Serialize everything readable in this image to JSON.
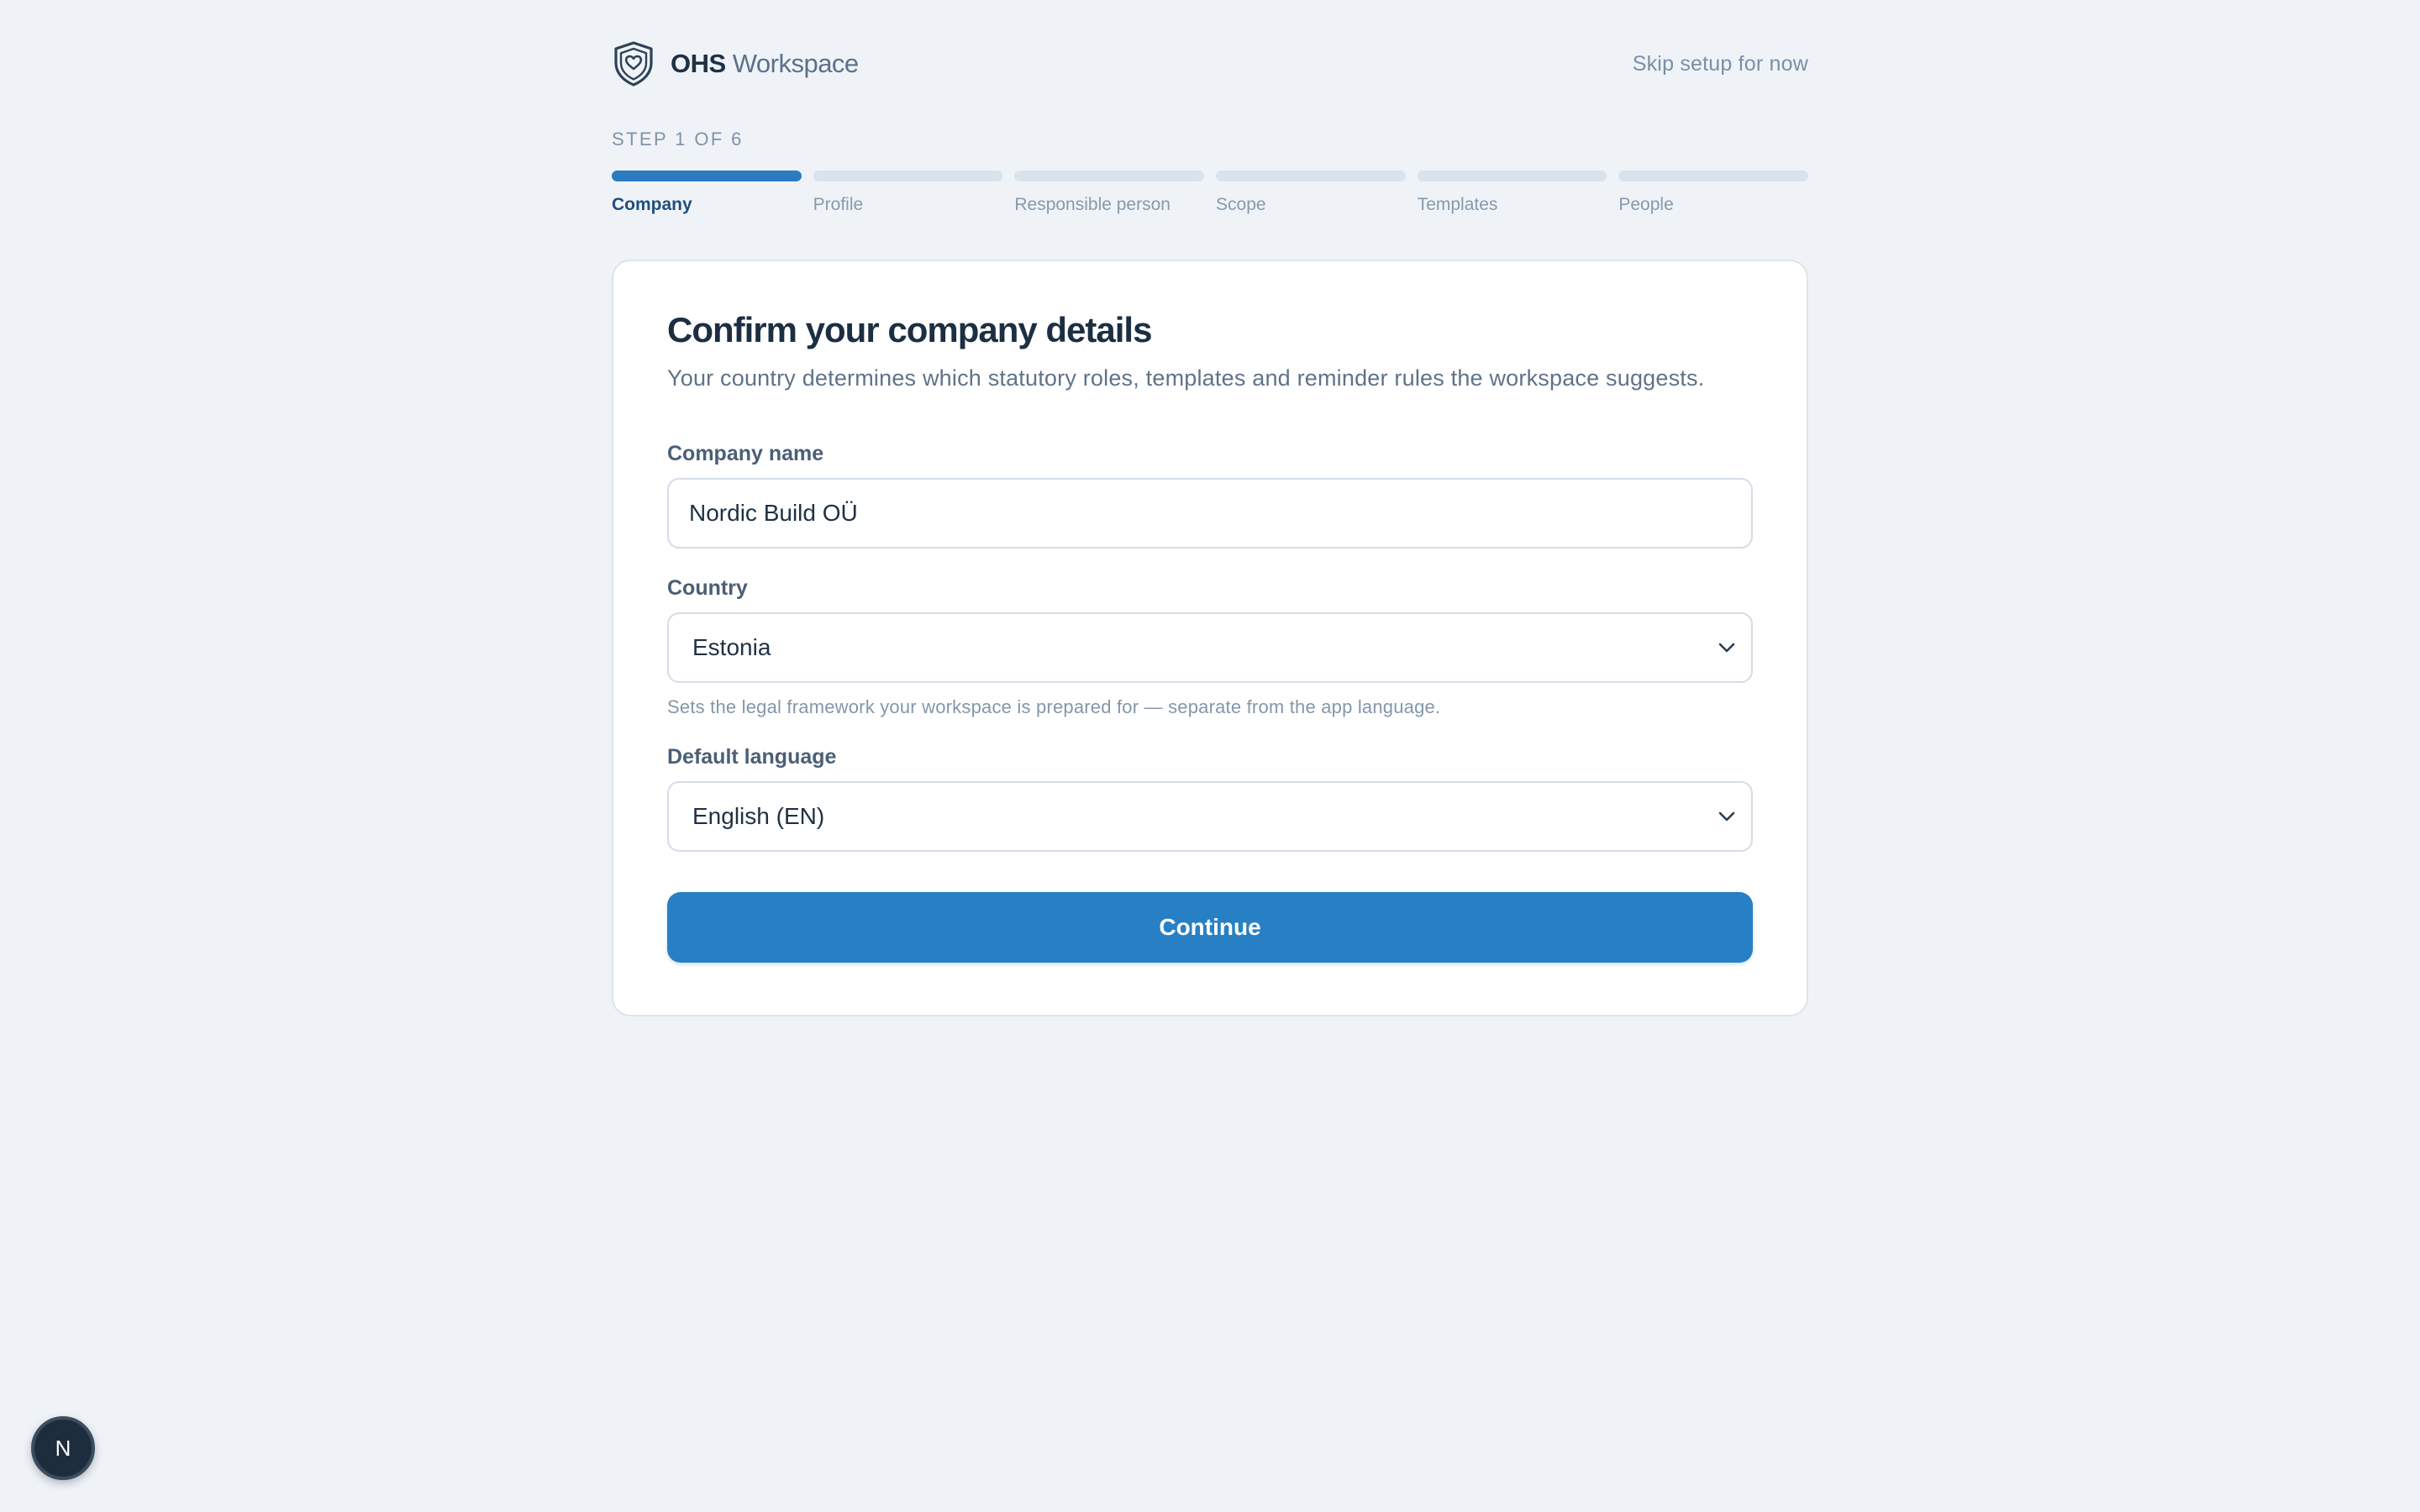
{
  "header": {
    "brand_strong": "OHS",
    "brand_light": "Workspace",
    "logo_icon": "shield-heart-icon",
    "skip_label": "Skip setup for now"
  },
  "progress": {
    "step_label": "STEP 1 OF 6",
    "current_step": 1,
    "total_steps": 6,
    "steps": [
      {
        "label": "Company",
        "active": true
      },
      {
        "label": "Profile",
        "active": false
      },
      {
        "label": "Responsible person",
        "active": false
      },
      {
        "label": "Scope",
        "active": false
      },
      {
        "label": "Templates",
        "active": false
      },
      {
        "label": "People",
        "active": false
      }
    ]
  },
  "form": {
    "title": "Confirm your company details",
    "subtitle": "Your country determines which statutory roles, templates and reminder rules the workspace suggests.",
    "company_name": {
      "label": "Company name",
      "value": "Nordic Build OÜ"
    },
    "country": {
      "label": "Country",
      "value": "Estonia",
      "helper": "Sets the legal framework your workspace is prepared for — separate from the app language."
    },
    "language": {
      "label": "Default language",
      "value": "English (EN)"
    },
    "continue_label": "Continue"
  },
  "avatar": {
    "initial": "N"
  },
  "colors": {
    "page_background": "#eff3f8",
    "accent": "#2880c4",
    "active_step_text": "#1f4f7d",
    "inactive_bar": "#d9e3ec"
  }
}
